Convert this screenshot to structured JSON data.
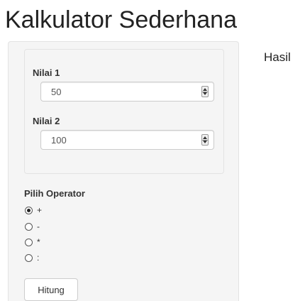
{
  "app": {
    "title": "Kalkulator Sederhana"
  },
  "inputs": {
    "nilai1": {
      "label": "Nilai 1",
      "value": "50"
    },
    "nilai2": {
      "label": "Nilai 2",
      "value": "100"
    }
  },
  "operator": {
    "label": "Pilih Operator",
    "options": [
      {
        "label": "+",
        "checked": true
      },
      {
        "label": "-",
        "checked": false
      },
      {
        "label": "*",
        "checked": false
      },
      {
        "label": ":",
        "checked": false
      }
    ]
  },
  "actions": {
    "submit_label": "Hitung"
  },
  "result": {
    "label": "Hasil"
  }
}
